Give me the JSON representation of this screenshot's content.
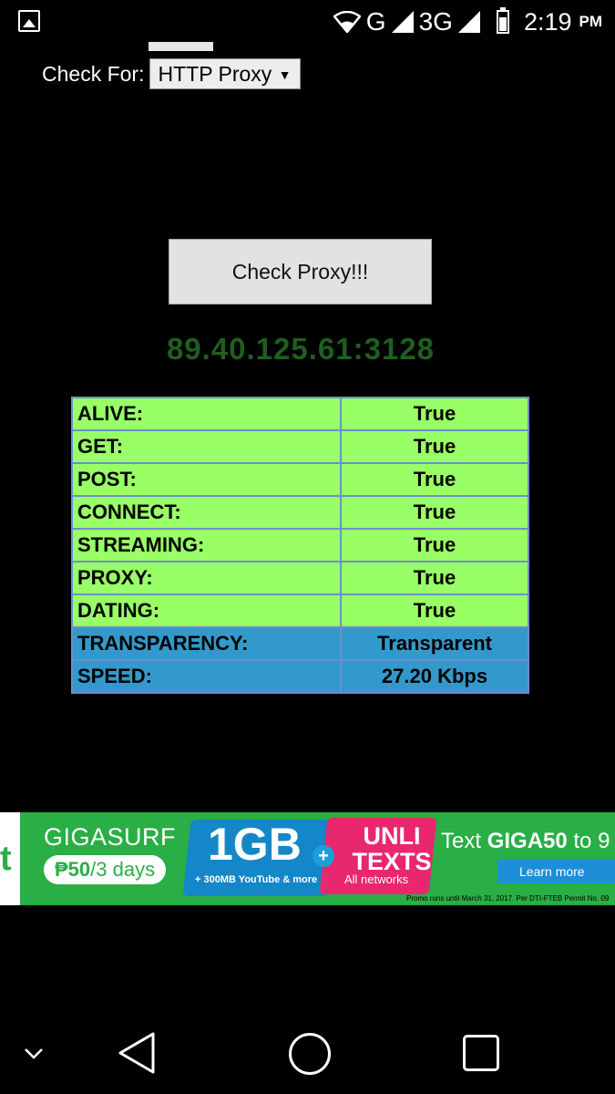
{
  "status_bar": {
    "network_1": "G",
    "network_2": "3G",
    "time": "2:19",
    "ampm": "PM",
    "icons": [
      "gallery-icon",
      "wifi-icon",
      "signal-icon",
      "battery-icon"
    ]
  },
  "form": {
    "check_for_label": "Check For:",
    "check_for_selected": "HTTP Proxy",
    "check_button_label": "Check Proxy!!!"
  },
  "result": {
    "proxy_address": "89.40.125.61:3128",
    "rows": [
      {
        "key": "ALIVE:",
        "value": "True"
      },
      {
        "key": "GET:",
        "value": "True"
      },
      {
        "key": "POST:",
        "value": "True"
      },
      {
        "key": "CONNECT:",
        "value": "True"
      },
      {
        "key": "STREAMING:",
        "value": "True"
      },
      {
        "key": "PROXY:",
        "value": "True"
      },
      {
        "key": "DATING:",
        "value": "True"
      },
      {
        "key": "TRANSPARENCY:",
        "value": "Transparent"
      },
      {
        "key": "SPEED:",
        "value": "27.20 Kbps"
      }
    ]
  },
  "ad": {
    "brand_letter": "t",
    "title": "GIGASURF",
    "price": "₱50",
    "price_period": "/3 days",
    "data_offer": "1GB",
    "data_sub": "+ 300MB YouTube & more",
    "texts_offer": "UNLI TEXTS",
    "texts_sub": "All networks",
    "cta_text": "Text ",
    "cta_code": "GIGA50",
    "cta_to": " to 9",
    "learn_more": "Learn more",
    "fine_print": "Promo runs until March 31, 2017. Per DTI-FTEB Permit No. 09"
  },
  "colors": {
    "ok_row": "#99ff66",
    "info_row": "#3399cc",
    "proxy_text": "#1f5e1f",
    "ad_green": "#2aae46"
  }
}
